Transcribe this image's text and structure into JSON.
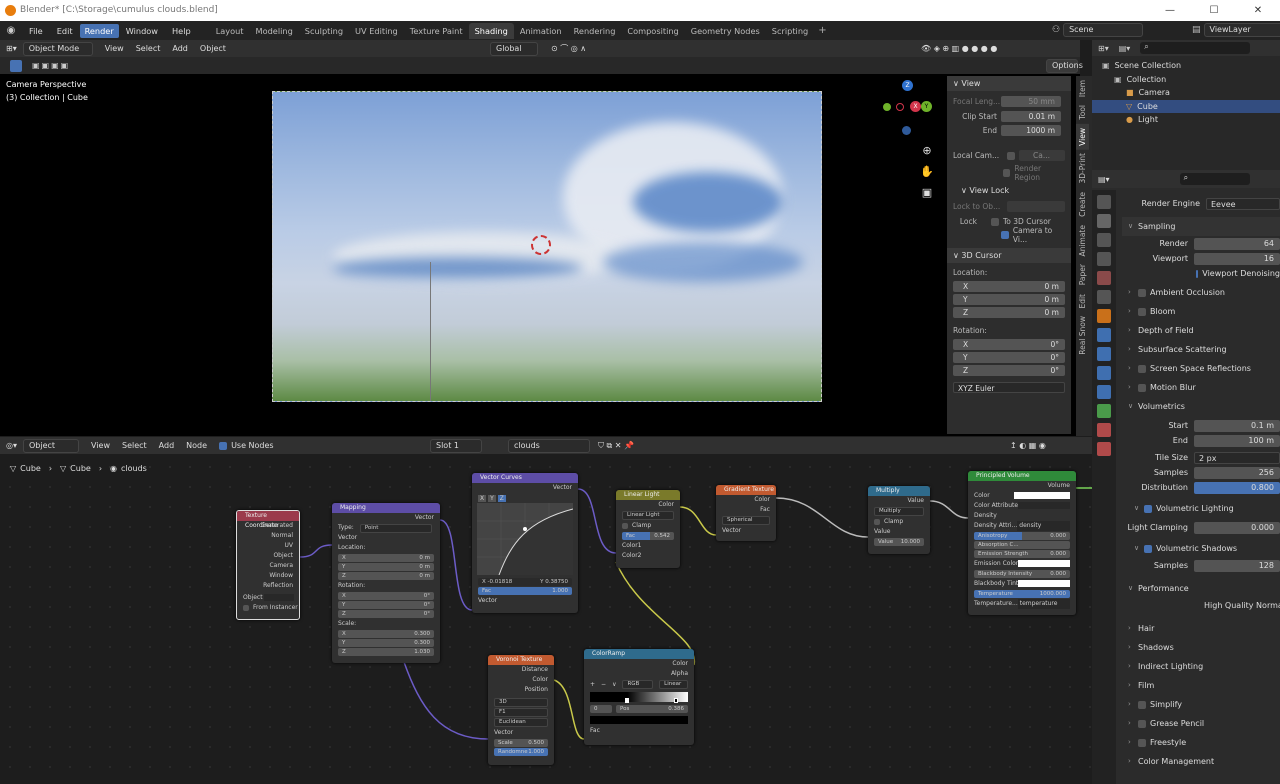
{
  "window": {
    "title": "Blender* [C:\\Storage\\cumulus clouds.blend]"
  },
  "menu": [
    "File",
    "Edit",
    "Render",
    "Window",
    "Help"
  ],
  "workspaces": [
    "Layout",
    "Modeling",
    "Sculpting",
    "UV Editing",
    "Texture Paint",
    "Shading",
    "Animation",
    "Rendering",
    "Compositing",
    "Geometry Nodes",
    "Scripting"
  ],
  "scene": "Scene",
  "view_layer": "ViewLayer",
  "viewport": {
    "mode": "Object Mode",
    "menus": [
      "View",
      "Select",
      "Add",
      "Object"
    ],
    "transform": "Global",
    "options": "Options",
    "overlay_title": "Camera Perspective",
    "overlay_sub": "(3) Collection | Cube",
    "gizmo": {
      "x": "X",
      "y": "Y",
      "z": "Z"
    }
  },
  "npanel": {
    "view_header": "View",
    "focal_label": "Focal Leng...",
    "focal": "50 mm",
    "clip_start_label": "Clip Start",
    "clip_start": "0.01 m",
    "end_label": "End",
    "clip_end": "1000 m",
    "local_cam_label": "Local Cam...",
    "local_cam_val": "Ca...",
    "render_region": "Render Region",
    "view_lock": "View Lock",
    "lock_obj": "Lock to Ob...",
    "lock": "Lock",
    "to_3d_cursor": "To 3D Cursor",
    "camera_to_view": "Camera to Vi...",
    "cursor_header": "3D Cursor",
    "location": "Location:",
    "lx": "0 m",
    "ly": "0 m",
    "lz": "0 m",
    "rotation": "Rotation:",
    "rx": "0°",
    "ry": "0°",
    "rz": "0°",
    "rot_mode": "XYZ Euler",
    "axis": {
      "x": "X",
      "y": "Y",
      "z": "Z"
    }
  },
  "vtabs": [
    "Item",
    "Tool",
    "View",
    "3D-Print",
    "Create",
    "Animate",
    "Paper",
    "Edit",
    "Real Snow"
  ],
  "node_editor": {
    "type": "Object",
    "menus": [
      "View",
      "Select",
      "Add",
      "Node"
    ],
    "use_nodes": "Use Nodes",
    "slot": "Slot 1",
    "material": "clouds",
    "breadcrumb": [
      "Cube",
      "Cube",
      "clouds"
    ]
  },
  "nodes": {
    "texcoord": {
      "title": "Texture Coordinate",
      "outs": [
        "Generated",
        "Normal",
        "UV",
        "Object",
        "Camera",
        "Window",
        "Reflection"
      ],
      "object": "Object",
      "from_instancer": "From Instancer"
    },
    "mapping": {
      "title": "Mapping",
      "out": "Vector",
      "type_label": "Type:",
      "type": "Point",
      "vector": "Vector",
      "location": "Location:",
      "rotation": "Rotation:",
      "scale": "Scale:",
      "loc": [
        "0 m",
        "0 m",
        "0 m"
      ],
      "rot": [
        "0°",
        "0°",
        "0°"
      ],
      "scl": [
        "0.300",
        "0.300",
        "1.030"
      ],
      "axes": [
        "X",
        "Y",
        "Z"
      ]
    },
    "curves": {
      "title": "Vector Curves",
      "out": "Vector",
      "x": "X -0.01818",
      "y": "Y 0.38750",
      "fac_label": "Fac",
      "fac": "1.000",
      "in": "Vector",
      "chan": [
        "X",
        "Y",
        "Z"
      ]
    },
    "linear": {
      "title": "Linear Light",
      "out": "Color",
      "mode": "Linear Light",
      "clamp": "Clamp",
      "fac_label": "Fac",
      "fac": "0.542",
      "c1": "Color1",
      "c2": "Color2"
    },
    "gradient": {
      "title": "Gradient Texture",
      "outs": [
        "Color",
        "Fac"
      ],
      "type": "Spherical",
      "in": "Vector"
    },
    "multiply": {
      "title": "Multiply",
      "out": "Value",
      "op": "Multiply",
      "clamp": "Clamp",
      "in": "Value",
      "val_label": "Value",
      "val": "10.000"
    },
    "volume": {
      "title": "Principled Volume",
      "out": "Volume",
      "rows": [
        "Color",
        "Color Attribute",
        "Density",
        "Density Attri...",
        "Anisotropy",
        "Absorption C...",
        "Emission Strength",
        "Emission Color",
        "Blackbody Intensity",
        "Blackbody Tint",
        "Temperature",
        "Temperature..."
      ],
      "density_attr": "density",
      "anisotropy": "0.000",
      "emission_strength": "0.000",
      "bb_intensity": "0.000",
      "temperature": "1000.000",
      "temp_attr": "temperature"
    },
    "voronoi": {
      "title": "Voronoi Texture",
      "outs": [
        "Distance",
        "Color",
        "Position"
      ],
      "dim": "3D",
      "feature": "F1",
      "metric": "Euclidean",
      "in": "Vector",
      "scale_label": "Scale",
      "scale": "0.500",
      "rand_label": "Randomne",
      "rand": "1.000"
    },
    "ramp": {
      "title": "ColorRamp",
      "outs": [
        "Color",
        "Alpha"
      ],
      "ctrl": [
        "+",
        "−",
        "∨"
      ],
      "mode": "RGB",
      "interp": "Linear",
      "idx": "0",
      "pos_label": "Pos",
      "pos": "0.386",
      "in": "Fac"
    }
  },
  "outliner": {
    "items": [
      "Scene Collection",
      "Collection",
      "Camera",
      "Cube",
      "Light"
    ]
  },
  "properties": {
    "engine_label": "Render Engine",
    "engine": "Eevee",
    "sampling": "Sampling",
    "render_label": "Render",
    "render": "64",
    "viewport_label": "Viewport",
    "viewport": "16",
    "vp_denoise": "Viewport Denoising",
    "sections1": [
      "Ambient Occlusion",
      "Bloom",
      "Depth of Field",
      "Subsurface Scattering",
      "Screen Space Reflections",
      "Motion Blur"
    ],
    "volumetrics": "Volumetrics",
    "start_label": "Start",
    "start": "0.1 m",
    "end_label": "End",
    "end": "100 m",
    "tile_label": "Tile Size",
    "tile": "2 px",
    "samples_label": "Samples",
    "samples": "256",
    "dist_label": "Distribution",
    "dist": "0.800",
    "vol_light": "Volumetric Lighting",
    "light_clamp_label": "Light Clamping",
    "light_clamp": "0.000",
    "vol_shadows": "Volumetric Shadows",
    "shadow_samples_label": "Samples",
    "shadow_samples": "128",
    "performance": "Performance",
    "hq_normals": "High Quality Normals",
    "sections2": [
      "Hair",
      "Shadows",
      "Indirect Lighting",
      "Film",
      "Simplify",
      "Grease Pencil",
      "Freestyle",
      "Color Management"
    ]
  },
  "colors": {
    "accent": "#4772b3",
    "texture_node": "#c25a30",
    "input_node": "#9b3a4c",
    "vector_node": "#5d4da6",
    "converter_node": "#2f6b8c",
    "color_node": "#7a7a2a",
    "shader_node": "#2f8a3a"
  }
}
